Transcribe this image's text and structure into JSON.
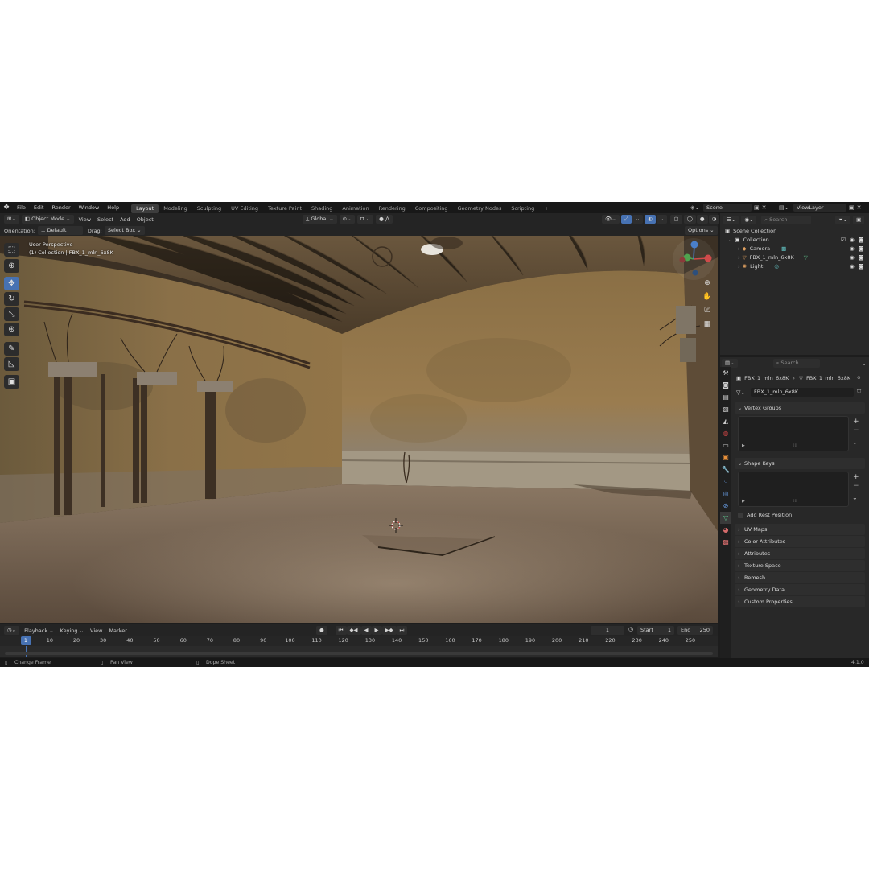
{
  "menu": [
    "File",
    "Edit",
    "Render",
    "Window",
    "Help"
  ],
  "workspaces": [
    "Layout",
    "Modeling",
    "Sculpting",
    "UV Editing",
    "Texture Paint",
    "Shading",
    "Animation",
    "Rendering",
    "Compositing",
    "Geometry Nodes",
    "Scripting"
  ],
  "active_workspace": "Layout",
  "scene_name": "Scene",
  "view_layer": "ViewLayer",
  "viewport_header": {
    "mode": "Object Mode",
    "menus": [
      "View",
      "Select",
      "Add",
      "Object"
    ],
    "transform_orientation": "Global",
    "orientation_label": "Orientation:",
    "orientation_value": "Default",
    "drag_label": "Drag:",
    "drag_value": "Select Box",
    "options": "Options"
  },
  "viewport_overlay": {
    "view_name": "User Perspective",
    "collection_info": "(1) Collection | FBX_1_mln_6x8K"
  },
  "outliner": {
    "search_placeholder": "Search",
    "scene_collection": "Scene Collection",
    "collection": "Collection",
    "objects": [
      "Camera",
      "FBX_1_mln_6x8K",
      "Light"
    ]
  },
  "properties": {
    "search_placeholder": "Search",
    "breadcrumb_object": "FBX_1_mln_6x8K",
    "breadcrumb_mesh": "FBX_1_mln_6x8K",
    "data_name": "FBX_1_mln_6x8K",
    "panels_open": [
      "Vertex Groups",
      "Shape Keys"
    ],
    "add_rest_position": "Add Rest Position",
    "panels_closed": [
      "UV Maps",
      "Color Attributes",
      "Attributes",
      "Texture Space",
      "Remesh",
      "Geometry Data",
      "Custom Properties"
    ]
  },
  "timeline": {
    "menus": [
      "Playback",
      "Keying",
      "View",
      "Marker"
    ],
    "current_frame": "1",
    "start_label": "Start",
    "start_value": "1",
    "end_label": "End",
    "end_value": "250",
    "ruler": [
      "1",
      "10",
      "20",
      "30",
      "40",
      "50",
      "60",
      "70",
      "80",
      "90",
      "100",
      "110",
      "120",
      "130",
      "140",
      "150",
      "160",
      "170",
      "180",
      "190",
      "200",
      "210",
      "220",
      "230",
      "240",
      "250"
    ]
  },
  "status_bar": {
    "items": [
      "Change Frame",
      "Pan View",
      "Dope Sheet"
    ],
    "version": "4.1.0"
  },
  "colors": {
    "accent": "#4772b3",
    "background": "#1d1d1d",
    "panel": "#282828"
  }
}
